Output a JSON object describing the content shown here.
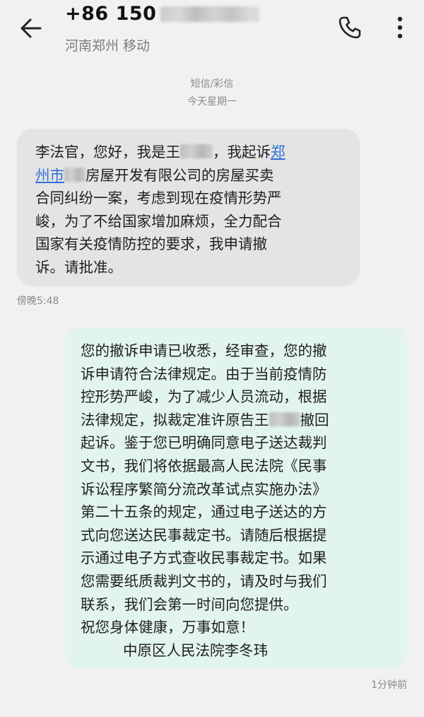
{
  "header": {
    "phone_prefix": "+86 150",
    "location": "河南郑州 移动",
    "icons": {
      "back": "arrow-left-icon",
      "call": "phone-icon",
      "more": "more-vertical-icon"
    }
  },
  "thread": {
    "message_type": "短信/彩信",
    "date": "今天星期一"
  },
  "incoming": {
    "line1_a": "李法官，您好，我是王",
    "line1_b": "，我起诉",
    "line1_link": "郑",
    "line2_link": "州市",
    "line2_b": "房屋开发有限公司的房屋买卖",
    "lines": [
      "合同纠纷一案，考虑到现在疫情形势严",
      "峻，为了不给国家增加麻烦，全力配合",
      "国家有关疫情防控的要求，我申请撤",
      "诉。请批准。"
    ],
    "time": "傍晚5:48"
  },
  "outgoing": {
    "line1": "您的撤诉申请已收悉，经审查，您的撤",
    "line2": "诉申请符合法律规定。由于当前疫情防",
    "line3": "控形势严峻，为了减少人员流动，根据",
    "line4_a": "法律规定，拟裁定准许原告王",
    "line4_b": "撤回",
    "line5": "起诉。鉴于您已明确同意电子送达裁判",
    "line6": "文书，我们将依据最高人民法院《民事",
    "line7": "诉讼程序繁简分流改革试点实施办法》",
    "line8": "第二十五条的规定，通过电子送达的方",
    "line9": "式向您送达民事裁定书。请随后根据提",
    "line10": "示通过电子方式查收民事裁定书。如果",
    "line11": "您需要纸质裁判文书的，请及时与我们",
    "line12": "联系，我们会第一时间向您提供。",
    "line13": "祝您身体健康，万事如意！",
    "signature": "中原区人民法院李冬玮",
    "time": "1分钟前"
  },
  "colors": {
    "background": "#f1f1f1",
    "incoming_bubble": "#e4e4e4",
    "outgoing_bubble": "#e2f4ee",
    "link": "#2f6fd6"
  }
}
